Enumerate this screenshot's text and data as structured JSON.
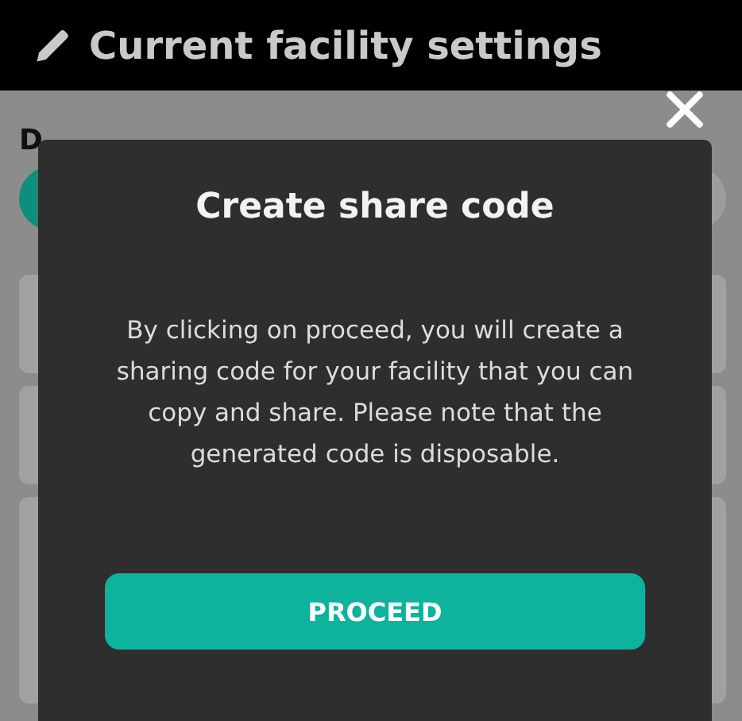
{
  "header": {
    "title": "Current facility settings"
  },
  "background": {
    "label": "D"
  },
  "dialog": {
    "title": "Create share code",
    "message": "By clicking on proceed, you will create a sharing code for your facility that you can copy and share. Please note that the generated code is disposable.",
    "button": "PROCEED"
  }
}
